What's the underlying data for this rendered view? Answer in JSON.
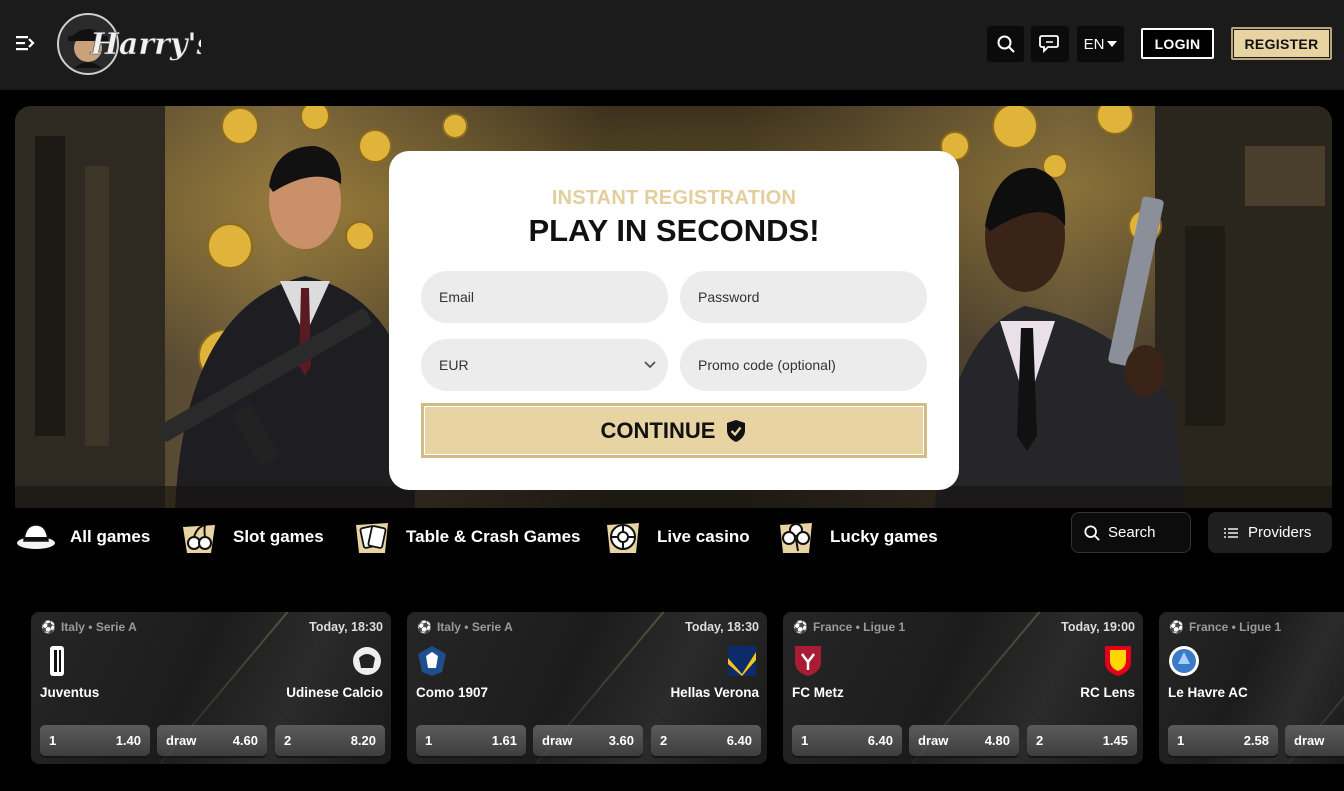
{
  "header": {
    "logo_text": "Harry's",
    "language": "EN",
    "login_label": "LOGIN",
    "register_label": "REGISTER"
  },
  "registration": {
    "subtitle": "INSTANT REGISTRATION",
    "title": "PLAY IN SECONDS!",
    "email_placeholder": "Email",
    "password_placeholder": "Password",
    "currency_value": "EUR",
    "promo_placeholder": "Promo code (optional)",
    "continue_label": "CONTINUE"
  },
  "categories": [
    {
      "label": "All games",
      "icon": "hat-icon"
    },
    {
      "label": "Slot games",
      "icon": "cherries-icon"
    },
    {
      "label": "Table & Crash Games",
      "icon": "cards-icon"
    },
    {
      "label": "Live casino",
      "icon": "roulette-icon"
    },
    {
      "label": "Lucky games",
      "icon": "clover-icon"
    }
  ],
  "search_label": "Search",
  "providers_label": "Providers",
  "matches": [
    {
      "league": "Italy • Serie A",
      "time": "Today, 18:30",
      "home": "Juventus",
      "away": "Udinese Calcio",
      "odds": [
        {
          "label": "1",
          "value": "1.40"
        },
        {
          "label": "draw",
          "value": "4.60"
        },
        {
          "label": "2",
          "value": "8.20"
        }
      ]
    },
    {
      "league": "Italy • Serie A",
      "time": "Today, 18:30",
      "home": "Como 1907",
      "away": "Hellas Verona",
      "odds": [
        {
          "label": "1",
          "value": "1.61"
        },
        {
          "label": "draw",
          "value": "3.60"
        },
        {
          "label": "2",
          "value": "6.40"
        }
      ]
    },
    {
      "league": "France • Ligue 1",
      "time": "Today, 19:00",
      "home": "FC Metz",
      "away": "RC Lens",
      "odds": [
        {
          "label": "1",
          "value": "6.40"
        },
        {
          "label": "draw",
          "value": "4.80"
        },
        {
          "label": "2",
          "value": "1.45"
        }
      ]
    },
    {
      "league": "France • Ligue 1",
      "time": "",
      "home": "Le Havre AC",
      "away": "",
      "odds": [
        {
          "label": "1",
          "value": "2.58"
        },
        {
          "label": "draw",
          "value": ""
        }
      ]
    }
  ],
  "colors": {
    "accent_gold": "#e8d4a2",
    "subtitle_gold": "#e2cf9c",
    "header_bg": "#1b1b1b"
  }
}
